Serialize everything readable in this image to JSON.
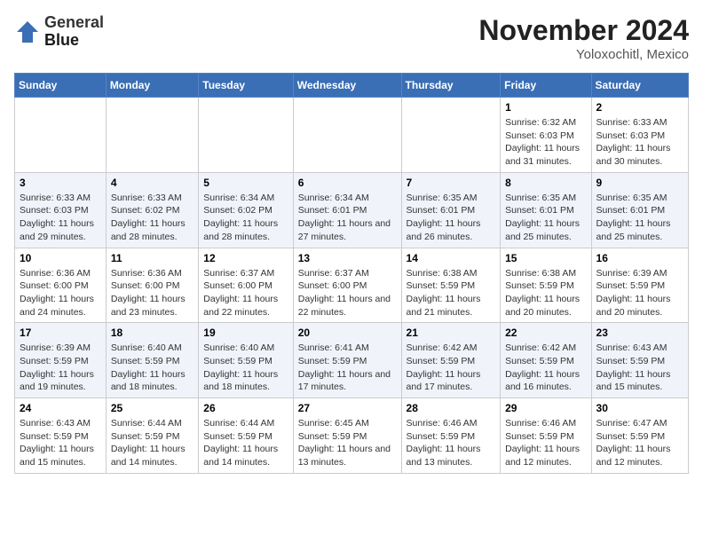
{
  "header": {
    "logo_line1": "General",
    "logo_line2": "Blue",
    "month_title": "November 2024",
    "location": "Yoloxochitl, Mexico"
  },
  "weekdays": [
    "Sunday",
    "Monday",
    "Tuesday",
    "Wednesday",
    "Thursday",
    "Friday",
    "Saturday"
  ],
  "weeks": [
    [
      {
        "day": "",
        "info": ""
      },
      {
        "day": "",
        "info": ""
      },
      {
        "day": "",
        "info": ""
      },
      {
        "day": "",
        "info": ""
      },
      {
        "day": "",
        "info": ""
      },
      {
        "day": "1",
        "info": "Sunrise: 6:32 AM\nSunset: 6:03 PM\nDaylight: 11 hours and 31 minutes."
      },
      {
        "day": "2",
        "info": "Sunrise: 6:33 AM\nSunset: 6:03 PM\nDaylight: 11 hours and 30 minutes."
      }
    ],
    [
      {
        "day": "3",
        "info": "Sunrise: 6:33 AM\nSunset: 6:03 PM\nDaylight: 11 hours and 29 minutes."
      },
      {
        "day": "4",
        "info": "Sunrise: 6:33 AM\nSunset: 6:02 PM\nDaylight: 11 hours and 28 minutes."
      },
      {
        "day": "5",
        "info": "Sunrise: 6:34 AM\nSunset: 6:02 PM\nDaylight: 11 hours and 28 minutes."
      },
      {
        "day": "6",
        "info": "Sunrise: 6:34 AM\nSunset: 6:01 PM\nDaylight: 11 hours and 27 minutes."
      },
      {
        "day": "7",
        "info": "Sunrise: 6:35 AM\nSunset: 6:01 PM\nDaylight: 11 hours and 26 minutes."
      },
      {
        "day": "8",
        "info": "Sunrise: 6:35 AM\nSunset: 6:01 PM\nDaylight: 11 hours and 25 minutes."
      },
      {
        "day": "9",
        "info": "Sunrise: 6:35 AM\nSunset: 6:01 PM\nDaylight: 11 hours and 25 minutes."
      }
    ],
    [
      {
        "day": "10",
        "info": "Sunrise: 6:36 AM\nSunset: 6:00 PM\nDaylight: 11 hours and 24 minutes."
      },
      {
        "day": "11",
        "info": "Sunrise: 6:36 AM\nSunset: 6:00 PM\nDaylight: 11 hours and 23 minutes."
      },
      {
        "day": "12",
        "info": "Sunrise: 6:37 AM\nSunset: 6:00 PM\nDaylight: 11 hours and 22 minutes."
      },
      {
        "day": "13",
        "info": "Sunrise: 6:37 AM\nSunset: 6:00 PM\nDaylight: 11 hours and 22 minutes."
      },
      {
        "day": "14",
        "info": "Sunrise: 6:38 AM\nSunset: 5:59 PM\nDaylight: 11 hours and 21 minutes."
      },
      {
        "day": "15",
        "info": "Sunrise: 6:38 AM\nSunset: 5:59 PM\nDaylight: 11 hours and 20 minutes."
      },
      {
        "day": "16",
        "info": "Sunrise: 6:39 AM\nSunset: 5:59 PM\nDaylight: 11 hours and 20 minutes."
      }
    ],
    [
      {
        "day": "17",
        "info": "Sunrise: 6:39 AM\nSunset: 5:59 PM\nDaylight: 11 hours and 19 minutes."
      },
      {
        "day": "18",
        "info": "Sunrise: 6:40 AM\nSunset: 5:59 PM\nDaylight: 11 hours and 18 minutes."
      },
      {
        "day": "19",
        "info": "Sunrise: 6:40 AM\nSunset: 5:59 PM\nDaylight: 11 hours and 18 minutes."
      },
      {
        "day": "20",
        "info": "Sunrise: 6:41 AM\nSunset: 5:59 PM\nDaylight: 11 hours and 17 minutes."
      },
      {
        "day": "21",
        "info": "Sunrise: 6:42 AM\nSunset: 5:59 PM\nDaylight: 11 hours and 17 minutes."
      },
      {
        "day": "22",
        "info": "Sunrise: 6:42 AM\nSunset: 5:59 PM\nDaylight: 11 hours and 16 minutes."
      },
      {
        "day": "23",
        "info": "Sunrise: 6:43 AM\nSunset: 5:59 PM\nDaylight: 11 hours and 15 minutes."
      }
    ],
    [
      {
        "day": "24",
        "info": "Sunrise: 6:43 AM\nSunset: 5:59 PM\nDaylight: 11 hours and 15 minutes."
      },
      {
        "day": "25",
        "info": "Sunrise: 6:44 AM\nSunset: 5:59 PM\nDaylight: 11 hours and 14 minutes."
      },
      {
        "day": "26",
        "info": "Sunrise: 6:44 AM\nSunset: 5:59 PM\nDaylight: 11 hours and 14 minutes."
      },
      {
        "day": "27",
        "info": "Sunrise: 6:45 AM\nSunset: 5:59 PM\nDaylight: 11 hours and 13 minutes."
      },
      {
        "day": "28",
        "info": "Sunrise: 6:46 AM\nSunset: 5:59 PM\nDaylight: 11 hours and 13 minutes."
      },
      {
        "day": "29",
        "info": "Sunrise: 6:46 AM\nSunset: 5:59 PM\nDaylight: 11 hours and 12 minutes."
      },
      {
        "day": "30",
        "info": "Sunrise: 6:47 AM\nSunset: 5:59 PM\nDaylight: 11 hours and 12 minutes."
      }
    ]
  ]
}
